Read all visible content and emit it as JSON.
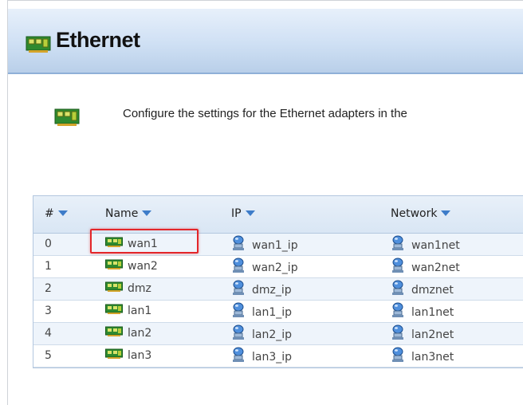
{
  "header": {
    "title": "Ethernet",
    "icon": "ethernet-card-icon"
  },
  "description": {
    "text": "Configure the settings for the Ethernet adapters in the",
    "icon": "ethernet-card-icon"
  },
  "table": {
    "columns": [
      "#",
      "Name",
      "IP",
      "Network"
    ],
    "rows": [
      {
        "num": "0",
        "name": "wan1",
        "ip": "wan1_ip",
        "network": "wan1net"
      },
      {
        "num": "1",
        "name": "wan2",
        "ip": "wan2_ip",
        "network": "wan2net"
      },
      {
        "num": "2",
        "name": "dmz",
        "ip": "dmz_ip",
        "network": "dmznet"
      },
      {
        "num": "3",
        "name": "lan1",
        "ip": "lan1_ip",
        "network": "lan1net"
      },
      {
        "num": "4",
        "name": "lan2",
        "ip": "lan2_ip",
        "network": "lan2net"
      },
      {
        "num": "5",
        "name": "lan3",
        "ip": "lan3_ip",
        "network": "lan3net"
      }
    ]
  },
  "colors": {
    "header_bg": "#cfe0f4",
    "sort_arrow": "#3d7cc9",
    "highlight": "#e3262a",
    "row_alt": "#eef4fb"
  }
}
